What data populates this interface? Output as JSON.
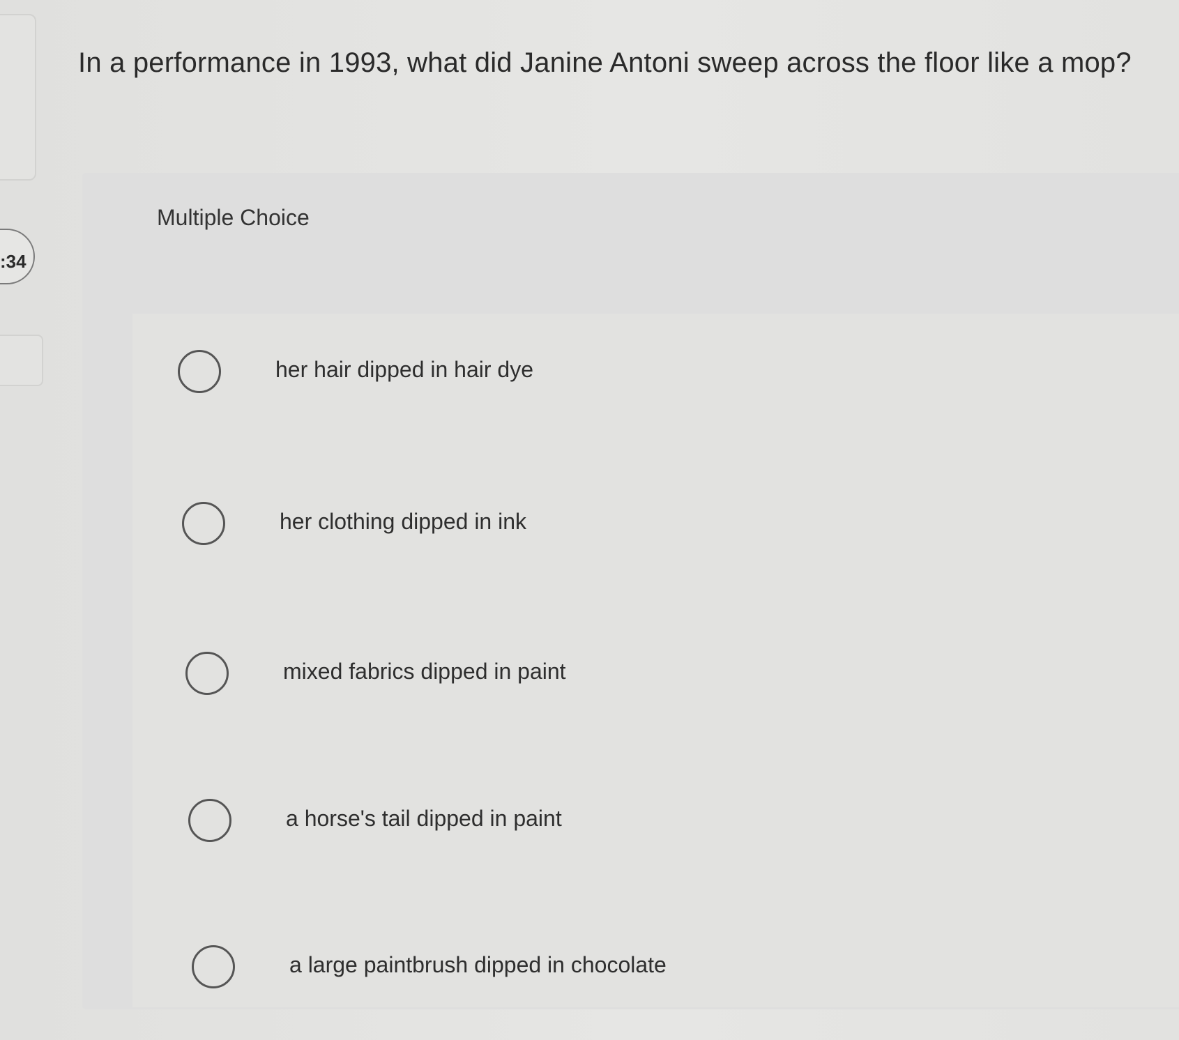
{
  "sidebar": {
    "question_number": ":34"
  },
  "question": {
    "text": "In a performance in 1993, what did Janine Antoni sweep across the floor like a mop?"
  },
  "answer_panel": {
    "type_label": "Multiple Choice",
    "options": [
      {
        "label": "her hair dipped in hair dye",
        "selected": false
      },
      {
        "label": "her clothing dipped in ink",
        "selected": false
      },
      {
        "label": "mixed fabrics dipped in paint",
        "selected": false
      },
      {
        "label": "a horse's tail dipped in paint",
        "selected": false
      },
      {
        "label": "a large paintbrush dipped in chocolate",
        "selected": false
      }
    ]
  }
}
